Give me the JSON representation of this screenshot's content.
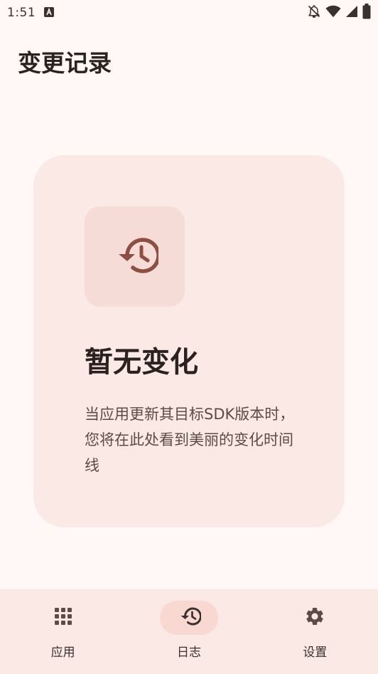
{
  "status_bar": {
    "time": "1:51",
    "icons": [
      "a-notification-icon",
      "bell-off-icon",
      "wifi-icon",
      "cellular-icon",
      "battery-icon"
    ]
  },
  "page": {
    "title": "变更记录"
  },
  "empty_state": {
    "icon": "history-icon",
    "heading": "暂无变化",
    "body": "当应用更新其目标SDK版本时，您将在此处看到美丽的变化时间线"
  },
  "bottom_nav": {
    "items": [
      {
        "label": "应用",
        "icon": "grid-icon",
        "active": false
      },
      {
        "label": "日志",
        "icon": "history-icon",
        "active": true
      },
      {
        "label": "设置",
        "icon": "gear-icon",
        "active": false
      }
    ]
  },
  "colors": {
    "background": "#fff8f6",
    "card": "#fbe9e5",
    "icon_box": "#f5dcd7",
    "accent": "#8c4f42",
    "active_pill": "#f9d8d1"
  }
}
